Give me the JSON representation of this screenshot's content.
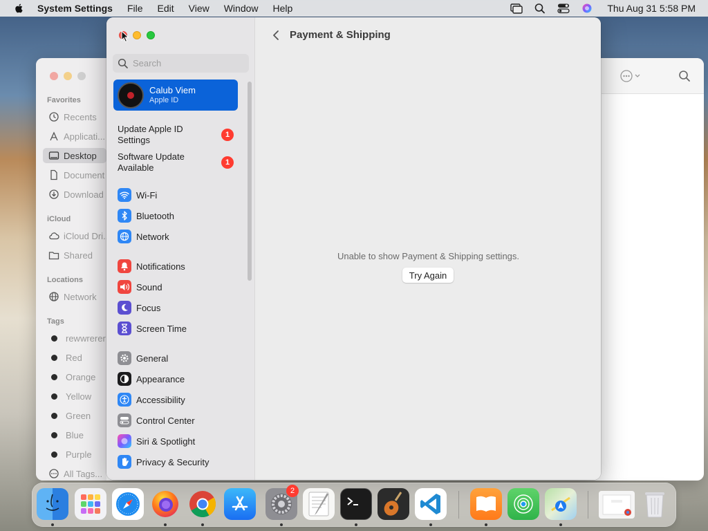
{
  "menubar": {
    "app_name": "System Settings",
    "menus": [
      "File",
      "Edit",
      "View",
      "Window",
      "Help"
    ],
    "clock": "Thu Aug 31  5:58 PM"
  },
  "finder": {
    "sections": {
      "favorites": "Favorites",
      "icloud": "iCloud",
      "locations": "Locations",
      "tags": "Tags"
    },
    "favorites": [
      "Recents",
      "Applicati...",
      "Desktop",
      "Document",
      "Download"
    ],
    "icloud": [
      "iCloud Dri...",
      "Shared"
    ],
    "locations": [
      "Network"
    ],
    "tags": [
      "rewwrerer",
      "Red",
      "Orange",
      "Yellow",
      "Green",
      "Blue",
      "Purple",
      "All Tags..."
    ]
  },
  "settings": {
    "search_placeholder": "Search",
    "account": {
      "name": "Calub Viem",
      "subtitle": "Apple ID"
    },
    "notices": [
      {
        "label": "Update Apple ID Settings",
        "badge": "1"
      },
      {
        "label": "Software Update Available",
        "badge": "1"
      }
    ],
    "nav": {
      "wifi": "Wi-Fi",
      "bluetooth": "Bluetooth",
      "network": "Network",
      "notifications": "Notifications",
      "sound": "Sound",
      "focus": "Focus",
      "screen_time": "Screen Time",
      "general": "General",
      "appearance": "Appearance",
      "accessibility": "Accessibility",
      "control_center": "Control Center",
      "siri": "Siri & Spotlight",
      "privacy": "Privacy & Security"
    },
    "page_title": "Payment & Shipping",
    "error_message": "Unable to show Payment & Shipping settings.",
    "try_again_label": "Try Again"
  },
  "dock": {
    "system_settings_badge": "2",
    "apps": [
      "Finder",
      "Launchpad",
      "Safari",
      "Firefox",
      "Chrome",
      "App Store",
      "System Settings",
      "TextEdit",
      "Terminal",
      "GarageBand",
      "VS Code",
      "Books",
      "Find My",
      "Maps",
      "Chrome window",
      "Trash"
    ]
  },
  "colors": {
    "accent": "#0b63d9",
    "badge": "#ff3b30"
  }
}
